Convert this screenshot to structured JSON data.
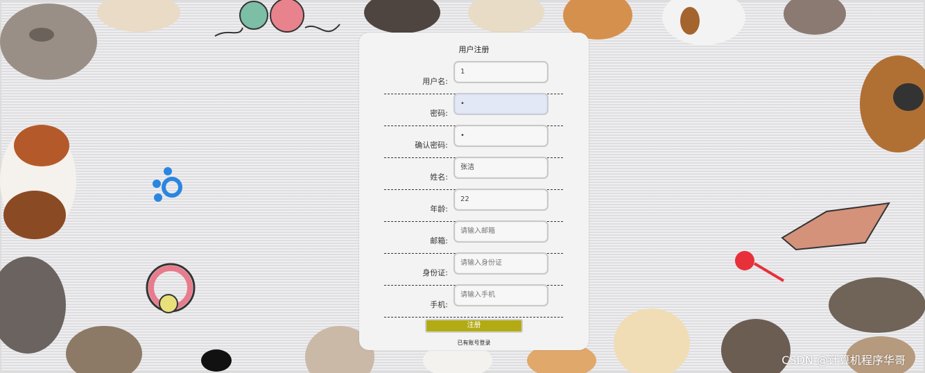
{
  "form": {
    "title": "用户注册",
    "fields": [
      {
        "label": "用户名:",
        "value": "1",
        "placeholder": "",
        "focused": false
      },
      {
        "label": "密码:",
        "value": "•",
        "placeholder": "",
        "focused": true
      },
      {
        "label": "确认密码:",
        "value": "•",
        "placeholder": "",
        "focused": false
      },
      {
        "label": "姓名:",
        "value": "张洁",
        "placeholder": "",
        "focused": false
      },
      {
        "label": "年龄:",
        "value": "22",
        "placeholder": "",
        "focused": false
      },
      {
        "label": "邮箱:",
        "value": "",
        "placeholder": "请输入邮箱",
        "focused": false
      },
      {
        "label": "身份证:",
        "value": "",
        "placeholder": "请输入身份证",
        "focused": false
      },
      {
        "label": "手机:",
        "value": "",
        "placeholder": "请输入手机",
        "focused": false
      }
    ],
    "submit_label": "注册",
    "login_link": "已有账号登录"
  },
  "watermark": "CSDN @计算机程序华哥",
  "colors": {
    "accent": "#b3ab14",
    "card": "#f3f3f3",
    "focused_input": "#e3e8f6"
  }
}
